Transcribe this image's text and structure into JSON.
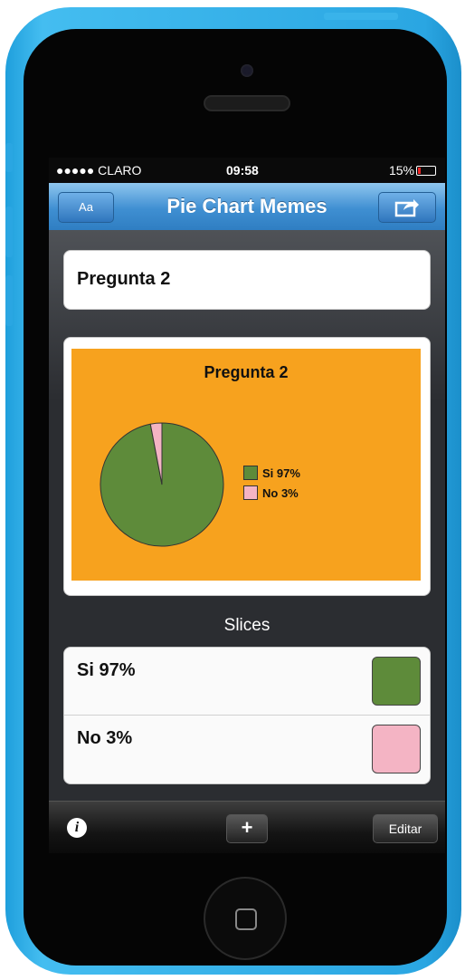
{
  "status_bar": {
    "carrier": "●●●●● CLARO",
    "time": "09:58",
    "battery_label": "15%",
    "battery_level": 0.15
  },
  "navbar": {
    "title": "Pie Chart Memes",
    "font_button_label": "Aa",
    "share_icon": "share-icon"
  },
  "question": {
    "text": "Pregunta 2"
  },
  "chart_data": {
    "type": "pie",
    "title": "Pregunta 2",
    "slices": [
      {
        "label": "Si 97%",
        "value": 97,
        "color": "#5e8b3a"
      },
      {
        "label": "No 3%",
        "value": 3,
        "color": "#f4b4c4"
      }
    ],
    "background": "#f7a21e",
    "legend_position": "right"
  },
  "slices_section": {
    "heading": "Slices",
    "items": [
      {
        "label": "Si 97%",
        "color": "#5e8b3a"
      },
      {
        "label": "No 3%",
        "color": "#f4b4c4"
      }
    ]
  },
  "toolbar": {
    "info_label": "i",
    "add_label": "+",
    "edit_label": "Editar"
  }
}
